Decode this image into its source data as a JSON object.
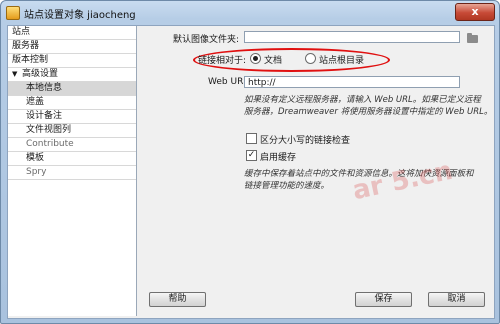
{
  "window": {
    "title": "站点设置对象 jiaocheng",
    "close_label": "x"
  },
  "sidebar": {
    "items": [
      {
        "label": "站点"
      },
      {
        "label": "服务器"
      },
      {
        "label": "版本控制"
      },
      {
        "label": "高级设置",
        "toggle": "▼"
      },
      {
        "label": "本地信息"
      },
      {
        "label": "遮盖"
      },
      {
        "label": "设计备注"
      },
      {
        "label": "文件视图列"
      },
      {
        "label": "Contribute"
      },
      {
        "label": "模板"
      },
      {
        "label": "Spry"
      }
    ]
  },
  "form": {
    "default_image_folder_label": "默认图像文件夹:",
    "default_image_folder_value": "",
    "links_relative_label": "链接相对于:",
    "option_document": "文档",
    "option_site_root": "站点根目录",
    "web_url_label": "Web URL:",
    "web_url_value": "http://",
    "web_url_note_line1": "如果没有定义远程服务器，请输入 Web URL。如果已定义远程",
    "web_url_note_line2": "服务器，Dreamweaver 将使用服务器设置中指定的 Web URL。",
    "case_sensitive_label": "区分大小写的链接检查",
    "case_sensitive_checked": false,
    "enable_cache_label": "启用缓存",
    "enable_cache_checked": true,
    "cache_note_line1": "缓存中保存着站点中的文件和资源信息。这将加快资源面板和",
    "cache_note_line2": "链接管理功能的速度。"
  },
  "buttons": {
    "help": "帮助",
    "save": "保存",
    "cancel": "取消"
  },
  "watermark": "ar 5.cn"
}
